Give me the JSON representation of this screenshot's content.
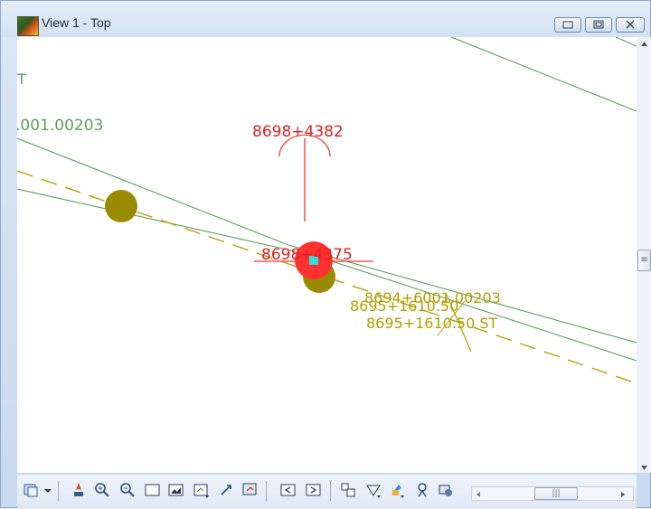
{
  "window": {
    "title": "View 1 - Top",
    "controls": {
      "minimize": "minimize",
      "restore": "restore",
      "close": "close"
    }
  },
  "canvas": {
    "labels": {
      "left_top_clip": "T",
      "left_alignment": ".001.00203",
      "pi_station": "8698+4382",
      "center_station": "8698+4375",
      "cluster_1": "8694+6001.00203",
      "cluster_2": "8695+1610.50",
      "cluster_3": "8695+1610.50  ST"
    },
    "colors": {
      "alignment_green": "#5aa05a",
      "red_marker": "#ff3030",
      "cyan_point": "#33dddd",
      "olive_point": "#9a8a00",
      "dashed_line": "#b39a00",
      "olive_text": "#b0a000"
    }
  },
  "toolbar": {
    "icons": [
      "view-control-icon",
      "dropdown-arrow-icon",
      "pan-icon",
      "zoom-in-icon",
      "zoom-out-icon",
      "window-area-icon",
      "fit-view-icon",
      "view-properties-icon",
      "rotate-view-icon",
      "copy-view-icon",
      "previous-view-icon",
      "next-view-icon",
      "camera-icon",
      "clip-volume-icon",
      "render-icon",
      "locate-icon",
      "settings-icon"
    ]
  },
  "scrollbars": {
    "horizontal_thumb_glyph": "|||",
    "vertical_thumb_glyph": "≡"
  }
}
